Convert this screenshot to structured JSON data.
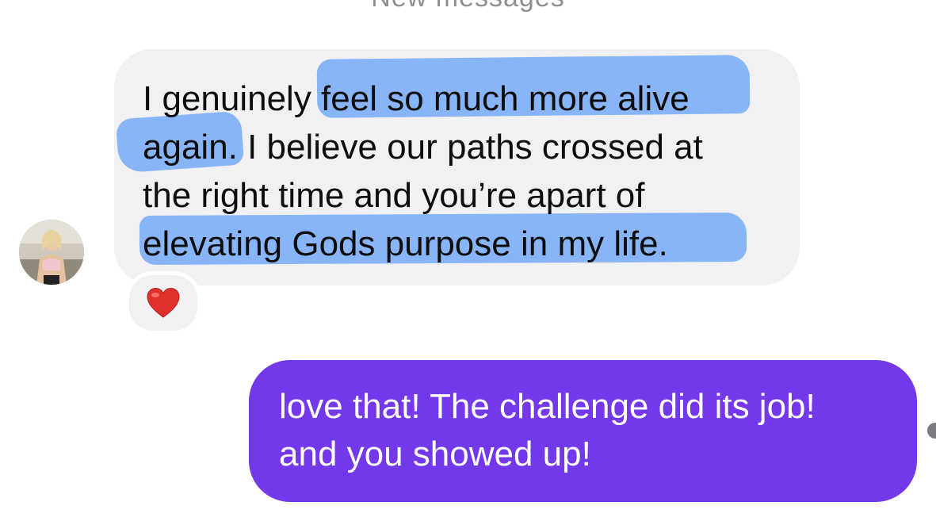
{
  "header": {
    "divider_label": "New messages"
  },
  "incoming_message": {
    "lines": [
      "I genuinely feel so much more alive",
      "again. I believe our paths crossed at",
      "the right time and you’re apart of",
      "elevating Gods purpose in my life."
    ],
    "reaction_icon": "red-heart-icon",
    "highlight_color": "#609ef8",
    "bubble_color": "#f1f1f3"
  },
  "outgoing_message": {
    "lines": [
      "love that! The challenge did its job!",
      "and you showed up!"
    ],
    "bubble_color": "#7338ea"
  },
  "colors": {
    "heart": "#e0302c",
    "text_dark": "#0d0d0d",
    "text_light": "#ffffff"
  }
}
